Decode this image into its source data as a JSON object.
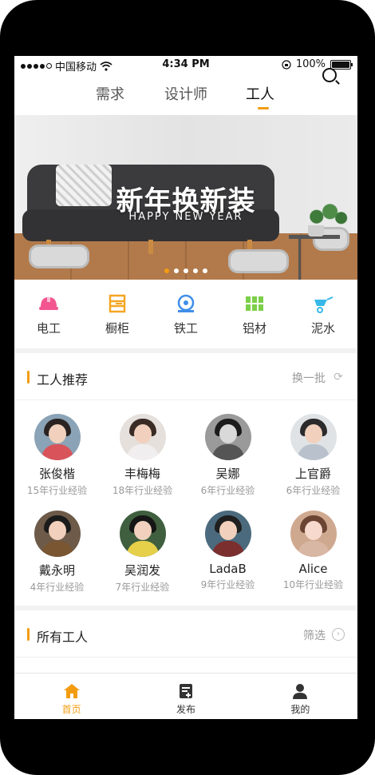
{
  "status_bar": {
    "carrier": "中国移动",
    "time": "4:34 PM",
    "battery": "100%",
    "battery_level": 1.0
  },
  "top_tabs": {
    "items": [
      {
        "label": "需求",
        "active": false
      },
      {
        "label": "设计师",
        "active": false
      },
      {
        "label": "工人",
        "active": true
      }
    ],
    "search_icon": "search-icon"
  },
  "banner": {
    "title": "新年换新装",
    "subtitle": "HAPPY NEW YEAR",
    "pages": 5,
    "current_page": 1
  },
  "categories": [
    {
      "label": "电工",
      "icon": "helmet-icon",
      "color": "#f2558f"
    },
    {
      "label": "橱柜",
      "icon": "cabinet-icon",
      "color": "#f4a623"
    },
    {
      "label": "铁工",
      "icon": "saw-icon",
      "color": "#3f8ee8"
    },
    {
      "label": "铝材",
      "icon": "window-icon",
      "color": "#7ccf48"
    },
    {
      "label": "泥水",
      "icon": "wheelbarrow-icon",
      "color": "#37b8e8"
    }
  ],
  "recommend": {
    "title": "工人推荐",
    "action": "换一批",
    "action_icon": "refresh-icon",
    "workers": [
      {
        "name": "张俊楷",
        "exp": "15年行业经验"
      },
      {
        "name": "丰梅梅",
        "exp": "18年行业经验"
      },
      {
        "name": "吴娜",
        "exp": "6年行业经验"
      },
      {
        "name": "上官爵",
        "exp": "6年行业经验"
      },
      {
        "name": "戴永明",
        "exp": "4年行业经验"
      },
      {
        "name": "吴润发",
        "exp": "7年行业经验"
      },
      {
        "name": "LadaB",
        "exp": "9年行业经验"
      },
      {
        "name": "Alice",
        "exp": "10年行业经验"
      }
    ]
  },
  "all_workers": {
    "title": "所有工人",
    "action": "筛选",
    "action_icon": "chevron-right-circle-icon"
  },
  "bottom_nav": {
    "items": [
      {
        "label": "首页",
        "icon": "home-icon",
        "active": true
      },
      {
        "label": "发布",
        "icon": "publish-icon",
        "active": false
      },
      {
        "label": "我的",
        "icon": "user-icon",
        "active": false
      }
    ]
  },
  "colors": {
    "accent": "#f39c12",
    "text": "#222222",
    "muted": "#999999"
  }
}
